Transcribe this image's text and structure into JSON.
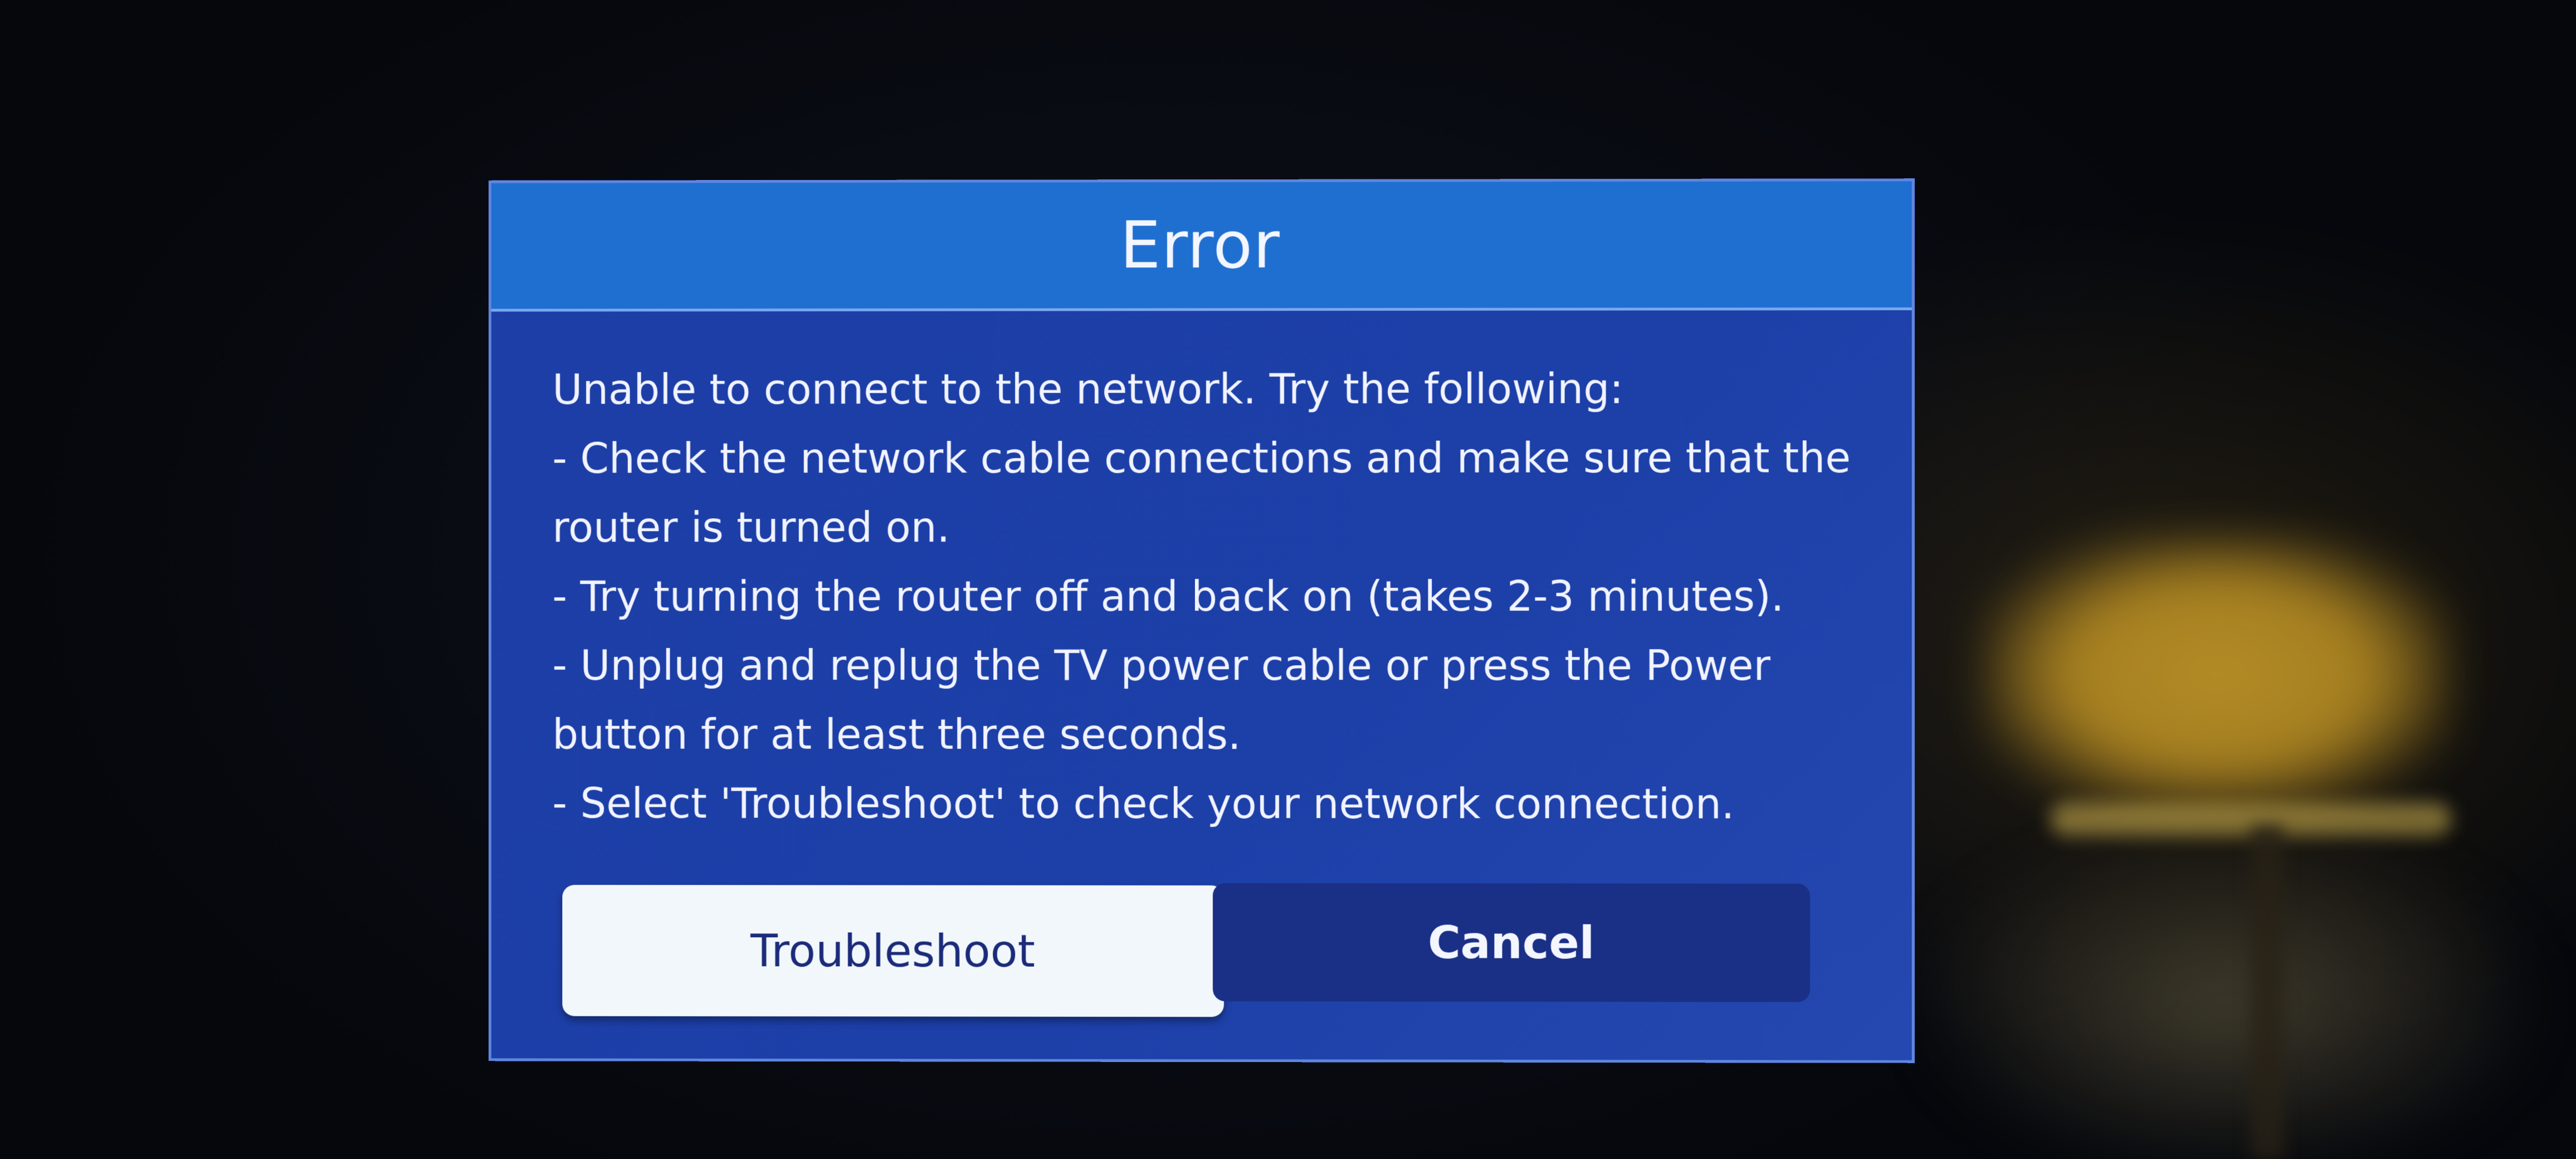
{
  "dialog": {
    "title": "Error",
    "message_lines": [
      "Unable to connect to the network. Try the following:",
      "- Check the network cable connections and make sure that the",
      "router is turned on.",
      "- Try turning the router off and back on (takes 2-3 minutes).",
      "- Unplug and replug the TV power cable or press the Power",
      "button for at least three seconds.",
      "- Select 'Troubleshoot' to check your network connection."
    ],
    "buttons": {
      "troubleshoot_label": "Troubleshoot",
      "cancel_label": "Cancel"
    },
    "focused_button": "Troubleshoot"
  },
  "colors": {
    "header": "#1f6fd1",
    "body": "#1d3ea6",
    "border": "#5f86e0",
    "focused_button_bg": "#f2f7fb",
    "unfocused_button_bg": "#1a2f86"
  }
}
